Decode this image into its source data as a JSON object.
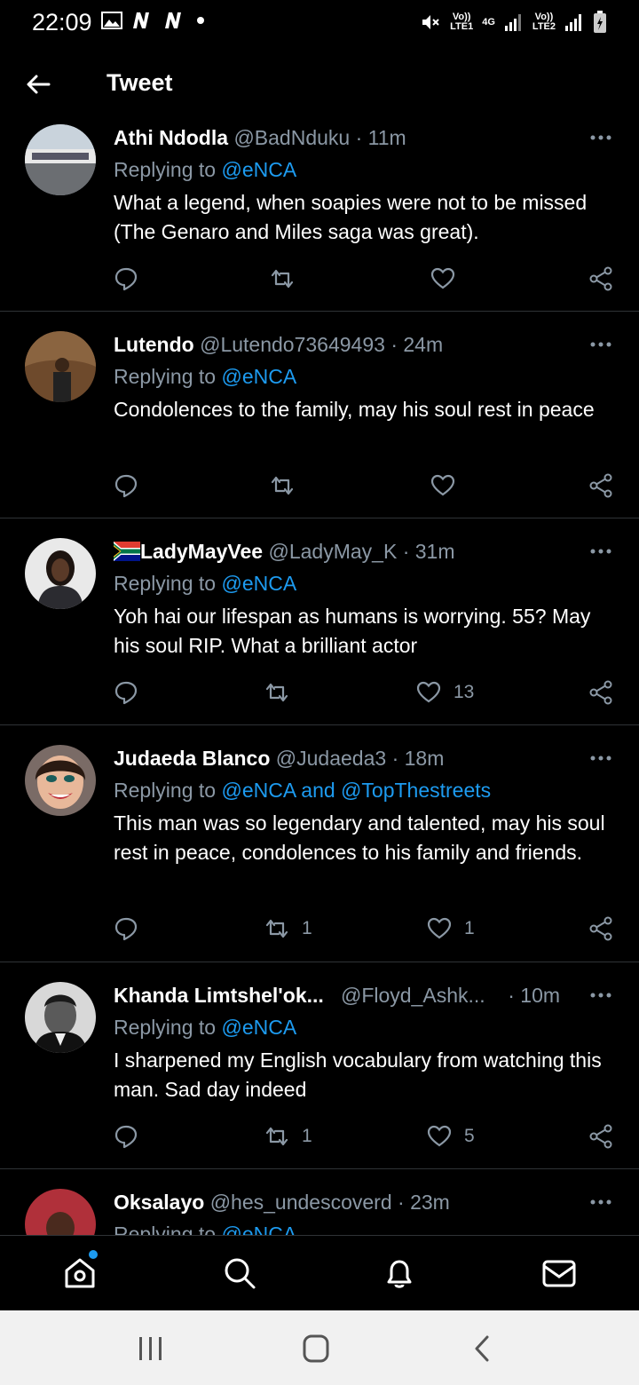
{
  "status_bar": {
    "time": "22:09",
    "sim1_label": "Vo))\nLTE1",
    "net_label": "4G",
    "sim2_label": "Vo))\nLTE2"
  },
  "header": {
    "title": "Tweet"
  },
  "tweets": [
    {
      "name": "Athi Ndodla",
      "handle": "@BadNduku",
      "time": "11m",
      "replying_prefix": "Replying to ",
      "replying_to": "@eNCA",
      "text": "What a legend, when soapies were not to be missed (The Genaro and Miles saga was great).",
      "retweets": "",
      "likes": ""
    },
    {
      "name": "Lutendo",
      "handle": "@Lutendo73649493",
      "time": "24m",
      "replying_prefix": "Replying to ",
      "replying_to": "@eNCA",
      "text": "Condolences to the family, may his soul rest in peace",
      "retweets": "",
      "likes": ""
    },
    {
      "name": "LadyMayVee",
      "handle": "@LadyMay_K",
      "time": "31m",
      "replying_prefix": "Replying to ",
      "replying_to": "@eNCA",
      "text": "Yoh hai our lifespan as humans is worrying. 55? May his soul RIP. What a brilliant actor",
      "retweets": "",
      "likes": "13"
    },
    {
      "name": "Judaeda Blanco",
      "handle": "@Judaeda3",
      "time": "18m",
      "replying_prefix": "Replying to ",
      "replying_to": "@eNCA and @TopThestreets",
      "text": "This man was so legendary and talented, may his soul rest in peace, condolences to his family and friends.",
      "retweets": "1",
      "likes": "1"
    },
    {
      "name": "Khanda Limtshel'ok...",
      "handle": "@Floyd_Ashk...",
      "time": "10m",
      "replying_prefix": "Replying to ",
      "replying_to": "@eNCA",
      "text": "I sharpened my English vocabulary from watching this man. Sad day indeed",
      "retweets": "1",
      "likes": "5"
    },
    {
      "name": "Oksalayo",
      "handle": "@hes_undescoverd",
      "time": "23m",
      "replying_prefix": "Replying to ",
      "replying_to": "@eNCA",
      "text": "",
      "retweets": "",
      "likes": ""
    }
  ],
  "separator": "·",
  "colors": {
    "accent": "#1d9bf0",
    "muted": "#8b98a5",
    "background": "#000000"
  },
  "icons": {
    "back": "arrow-left-icon",
    "reply": "comment-icon",
    "retweet": "retweet-icon",
    "like": "heart-icon",
    "share": "share-icon",
    "home": "home-icon",
    "search": "search-icon",
    "notifications": "bell-icon",
    "messages": "mail-icon"
  }
}
